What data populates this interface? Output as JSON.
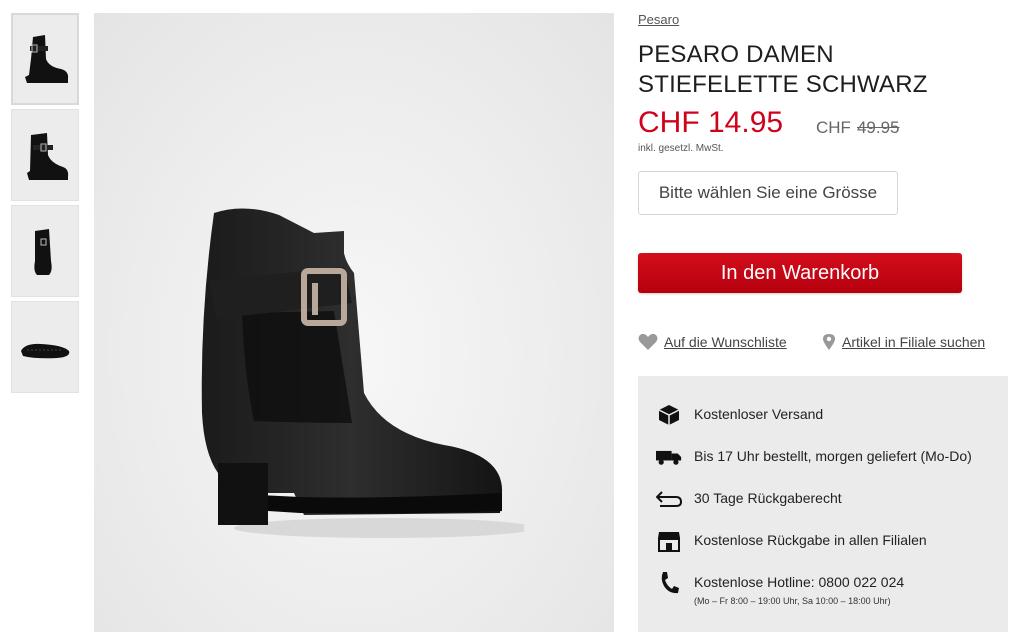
{
  "gallery": {
    "thumbnails": [
      {
        "view": "side-view"
      },
      {
        "view": "side-angle-view"
      },
      {
        "view": "front-view"
      },
      {
        "view": "sole-view"
      }
    ],
    "main_image": "black-ankle-boot-with-buckle"
  },
  "product": {
    "brand": "Pesaro",
    "title_line1": "PESARO DAMEN",
    "title_line2": "STIEFELETTE SCHWARZ",
    "price_now": "CHF 14.95",
    "price_old_currency": "CHF",
    "price_old_value": "49.95",
    "vat_note": "inkl. gesetzl. MwSt.",
    "size_placeholder": "Bitte wählen Sie eine Grösse",
    "cart_button": "In den Warenkorb",
    "wishlist_link": "Auf die Wunschliste",
    "store_link": "Artikel in Filiale suchen"
  },
  "benefits": [
    {
      "icon": "package-icon",
      "text": "Kostenloser Versand"
    },
    {
      "icon": "truck-icon",
      "text": "Bis 17 Uhr bestellt, morgen geliefert (Mo-Do)"
    },
    {
      "icon": "return-arrow-icon",
      "text": "30 Tage Rückgaberecht"
    },
    {
      "icon": "store-icon",
      "text": "Kostenlose Rückgabe in allen Filialen"
    },
    {
      "icon": "phone-icon",
      "text": "Kostenlose Hotline: 0800 022 024",
      "sub": "(Mo – Fr 8:00 – 19:00 Uhr, Sa 10:00 – 18:00 Uhr)"
    }
  ],
  "colors": {
    "accent": "#d0021b",
    "panel": "#ebebeb"
  }
}
